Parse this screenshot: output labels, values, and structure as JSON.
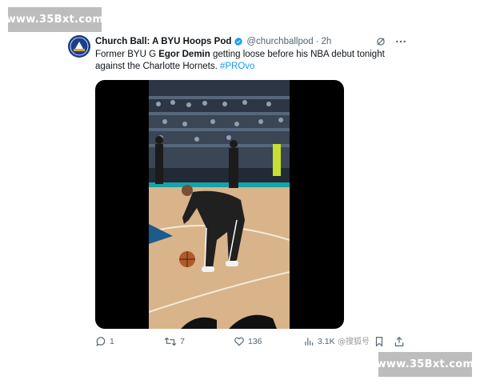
{
  "watermark": {
    "top": "www.35Bxt.com",
    "bottom": "www.35Bxt.com"
  },
  "tweet": {
    "author_name": "Church Ball: A BYU Hoops Pod",
    "handle": "@churchballpod",
    "separator": "·",
    "time": "2h",
    "text_part1": "Former BYU G ",
    "text_bold": "Egor Demin",
    "text_part2": " getting loose before his NBA debut tonight against the Charlotte Hornets. ",
    "hashtag": "#PROvo",
    "avatar_text": "CHURCH BALL"
  },
  "actions": {
    "replies": "1",
    "reposts": "7",
    "likes": "136",
    "views": "3.1K"
  },
  "source_tag": "@搜狐号",
  "colors": {
    "link": "#1d9bf0",
    "secondary": "#536471",
    "verified": "#1d9bf0",
    "watermark_bg": "#bdbdbd"
  },
  "icons": [
    "verified-badge-icon",
    "grok-icon",
    "more-icon",
    "reply-icon",
    "repost-icon",
    "like-icon",
    "views-icon",
    "bookmark-icon",
    "share-icon"
  ]
}
